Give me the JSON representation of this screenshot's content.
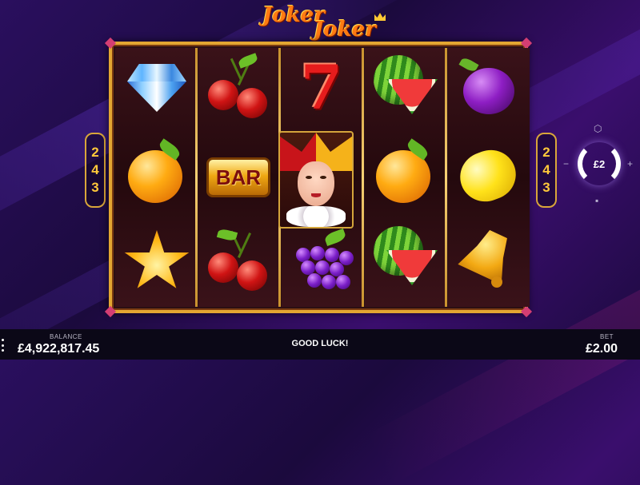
{
  "game": {
    "logo_line1": "Joker",
    "logo_line2": "Joker"
  },
  "ways": {
    "left": [
      "2",
      "4",
      "3"
    ],
    "right": [
      "2",
      "4",
      "3"
    ]
  },
  "reels": [
    [
      "diamond",
      "orange",
      "star"
    ],
    [
      "cherries",
      "bar",
      "cherries"
    ],
    [
      "seven",
      "joker",
      "grapes"
    ],
    [
      "watermelon",
      "orange",
      "watermelon"
    ],
    [
      "plum",
      "lemon",
      "bell"
    ]
  ],
  "symbols": {
    "bar_label": "BAR",
    "seven_label": "7"
  },
  "spin": {
    "bet_label": "£2"
  },
  "footer": {
    "balance_label": "BALANCE",
    "balance_value": "£4,922,817.45",
    "message": "GOOD LUCK!",
    "bet_label": "BET",
    "bet_value": "£2.00"
  }
}
